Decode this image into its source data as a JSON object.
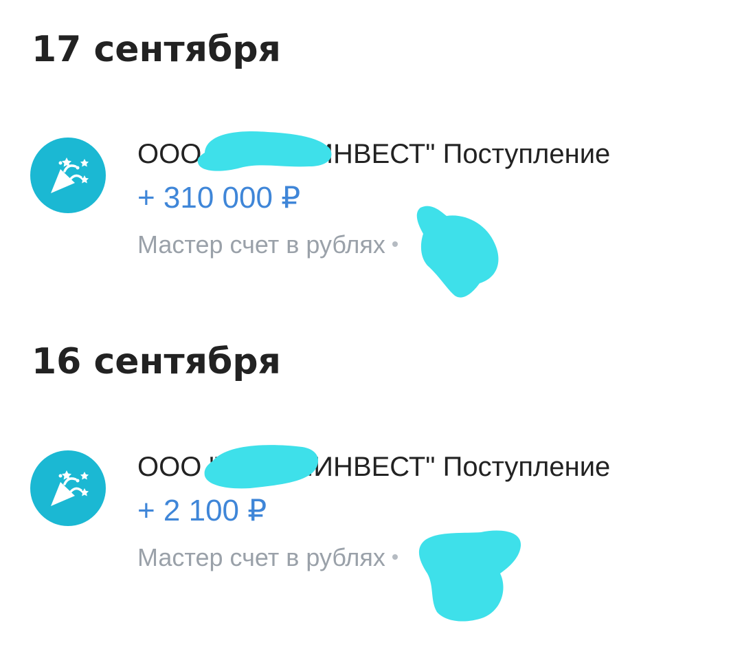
{
  "sections": [
    {
      "date": "17 сентября",
      "transactions": [
        {
          "icon": "party-popper-icon",
          "title": "ООО \"СТРОЙИНВЕСТ\" Поступление",
          "amount": "+ 310 000 ₽",
          "account": "Мастер счет в рублях"
        }
      ]
    },
    {
      "date": "16 сентября",
      "transactions": [
        {
          "icon": "party-popper-icon",
          "title": "ООО \"СТРОЙИНВЕСТ\" Поступление",
          "amount": "+ 2 100 ₽",
          "account": "Мастер счет в рублях"
        }
      ]
    }
  ],
  "colors": {
    "heading": "#222222",
    "amount_positive": "#3f86d8",
    "secondary_text": "#9aa1a9",
    "icon_bg": "#1bb8d3",
    "redaction_marker": "#3ee0ea"
  }
}
